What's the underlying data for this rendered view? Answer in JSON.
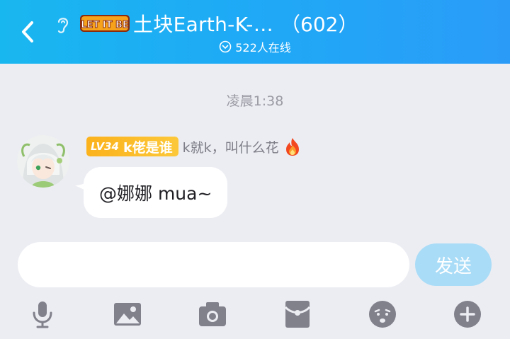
{
  "header": {
    "back_icon": "chevron-left-icon",
    "ear_icon": "ear-icon",
    "badge_text": "LET IT BE",
    "title": "土块Earth-K-…",
    "member_count": "（602）",
    "online_text": "522人在线",
    "online_icon": "chevron-down-circle-icon"
  },
  "chat": {
    "timestamp": "凌晨1:38",
    "message": {
      "level": "LV34",
      "level_title": "k佬是谁",
      "sender": "k就k，叫什么花",
      "sender_flair_icon": "fire-icon",
      "text": "@娜娜 mua~",
      "avatar_icon": "avatar-icon"
    }
  },
  "composer": {
    "input_value": "",
    "input_placeholder": "",
    "send_label": "发送"
  },
  "toolbar": {
    "items": [
      {
        "icon": "microphone-icon"
      },
      {
        "icon": "image-icon"
      },
      {
        "icon": "camera-icon"
      },
      {
        "icon": "red-packet-icon"
      },
      {
        "icon": "emoji-icon"
      },
      {
        "icon": "plus-icon"
      }
    ]
  },
  "colors": {
    "header_start": "#19b7f0",
    "header_end": "#2a9cf8",
    "background": "#ecedf3",
    "level_chip": "#fbb21c",
    "send_button": "#a9dcf7",
    "toolbar_icon": "#80818b"
  }
}
